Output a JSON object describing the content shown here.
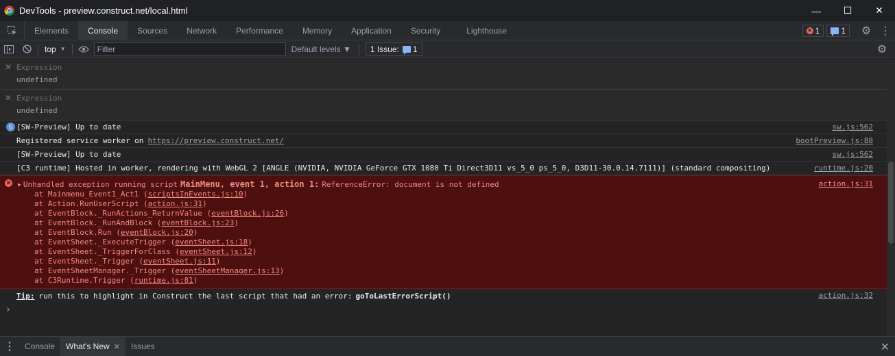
{
  "window": {
    "title": "DevTools - preview.construct.net/local.html",
    "minimize_glyph": "—",
    "maximize_glyph": "☐",
    "close_glyph": "✕"
  },
  "tabs": [
    "Elements",
    "Console",
    "Sources",
    "Network",
    "Performance",
    "Memory",
    "Application",
    "Security",
    "Lighthouse"
  ],
  "active_tab": "Console",
  "header_badges": {
    "errors": "1",
    "messages": "1"
  },
  "toolbar": {
    "context": "top",
    "filter_placeholder": "Filter",
    "levels": "Default levels ▼",
    "issues_label": "1 Issue:",
    "issues_count": "1"
  },
  "expressions": [
    {
      "label": "Expression",
      "value": "undefined"
    },
    {
      "label": "Expression",
      "value": "undefined"
    }
  ],
  "log": {
    "row1": {
      "count": "5",
      "text": "[SW-Preview] Up to date",
      "source": "sw.js:562"
    },
    "row2": {
      "text": "Registered service worker on",
      "link": "https://preview.construct.net/",
      "source": "bootPreview.js:88"
    },
    "row3": {
      "text": "[SW-Preview] Up to date",
      "source": "sw.js:562"
    },
    "row4": {
      "text": "[C3 runtime] Hosted in worker, rendering with WebGL 2 [ANGLE (NVIDIA, NVIDIA GeForce GTX 1080 Ti Direct3D11 vs_5_0 ps_5_0, D3D11-30.0.14.7111)] (standard compositing)",
      "source": "runtime.js:20"
    }
  },
  "error": {
    "prefix": "Unhandled exception running script",
    "location": "MainMenu, event 1, action 1:",
    "message": "ReferenceError: document is not defined",
    "source": "action.js:31",
    "stack": [
      {
        "fn": "at Mainmenu_Event1_Act1 (",
        "file": "scriptsInEvents.js:10"
      },
      {
        "fn": "at Action.RunUserScript (",
        "file": "action.js:31"
      },
      {
        "fn": "at EventBlock._RunActions_ReturnValue (",
        "file": "eventBlock.js:26"
      },
      {
        "fn": "at EventBlock._RunAndBlock (",
        "file": "eventBlock.js:23"
      },
      {
        "fn": "at EventBlock.Run (",
        "file": "eventBlock.js:20"
      },
      {
        "fn": "at EventSheet._ExecuteTrigger (",
        "file": "eventSheet.js:18"
      },
      {
        "fn": "at EventSheet._TriggerForClass (",
        "file": "eventSheet.js:12"
      },
      {
        "fn": "at EventSheet._Trigger (",
        "file": "eventSheet.js:11"
      },
      {
        "fn": "at EventSheetManager._Trigger (",
        "file": "eventSheetManager.js:13"
      },
      {
        "fn": "at C3Runtime.Trigger (",
        "file": "runtime.js:81"
      }
    ]
  },
  "tip": {
    "label": "Tip:",
    "text": "run this to highlight in Construct the last script that had an error:",
    "fn": "goToLastErrorScript()",
    "source": "action.js:32"
  },
  "prompt_glyph": "›",
  "drawer": {
    "tabs": [
      {
        "label": "Console",
        "active": false
      },
      {
        "label": "What's New",
        "active": true
      },
      {
        "label": "Issues",
        "active": false
      }
    ]
  },
  "colors": {
    "error_bg": "#4e0f0f",
    "error_text": "#f28b82",
    "accent_blue": "#8ab4f8"
  }
}
